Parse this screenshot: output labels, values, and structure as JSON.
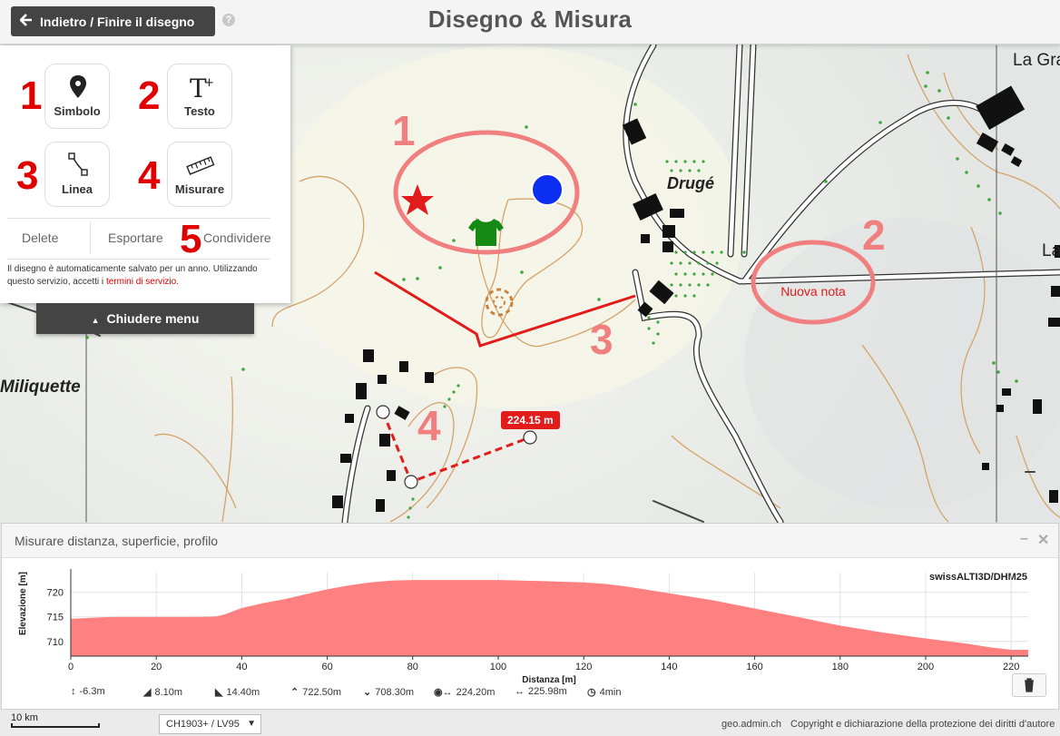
{
  "header": {
    "back_label": "Indietro / Finire il disegno",
    "title": "Disegno & Misura",
    "help_glyph": "?"
  },
  "tools": [
    {
      "number": "1",
      "label": "Simbolo",
      "icon": "map-marker-icon"
    },
    {
      "number": "2",
      "label": "Testo",
      "icon": "text-add-icon"
    },
    {
      "number": "3",
      "label": "Linea",
      "icon": "line-icon"
    },
    {
      "number": "4",
      "label": "Misurare",
      "icon": "ruler-icon"
    }
  ],
  "actions": {
    "delete": "Delete",
    "export": "Esportare",
    "share_number": "5",
    "share": "Condividere"
  },
  "notice": {
    "text": "Il disegno è automaticamente salvato per un anno. Utilizzando questo servizio, accetti i ",
    "link": "termini di servizio",
    "end": "."
  },
  "close_menu": "Chiudere menu",
  "map": {
    "places": [
      "La Gra",
      "Drugé",
      "La",
      "Miliquette"
    ],
    "annotations": [
      "1",
      "2",
      "3",
      "4"
    ],
    "note_text": "Nuova nota",
    "measure_label": "224.15 m",
    "colors": {
      "red": "#e21b1b",
      "pink": "#f08080",
      "blue": "#0b2ef0",
      "green": "#148a14"
    }
  },
  "profile": {
    "title": "Misurare distanza, superficie, profilo",
    "minimize": "–",
    "close": "✕",
    "stats": [
      {
        "icon": "updown-arrow-icon",
        "value": "-6.3m"
      },
      {
        "icon": "ascent-icon",
        "value": "8.10m"
      },
      {
        "icon": "descent-icon",
        "value": "14.40m"
      },
      {
        "icon": "chevron-up-icon",
        "value": "722.50m"
      },
      {
        "icon": "chevron-down-icon",
        "value": "708.30m"
      },
      {
        "icon": "eye-distance-icon",
        "value": "224.20m"
      },
      {
        "icon": "horizontal-distance-icon",
        "value": "225.98m"
      },
      {
        "icon": "clock-icon",
        "value": "4min"
      }
    ]
  },
  "chart_data": {
    "type": "area",
    "title": "swissALTI3D/DHM25",
    "xlabel": "Distanza [m]",
    "ylabel": "Elevazione [m]",
    "xlim": [
      0,
      224
    ],
    "ylim": [
      707,
      724
    ],
    "x_ticks": [
      0,
      20,
      40,
      60,
      80,
      100,
      120,
      140,
      160,
      180,
      200,
      220
    ],
    "y_ticks": [
      710,
      715,
      720
    ],
    "grid": true,
    "color": "#ff8080",
    "x": [
      0,
      5,
      10,
      20,
      30,
      34,
      36,
      40,
      45,
      50,
      55,
      60,
      65,
      70,
      75,
      80,
      90,
      100,
      110,
      120,
      125,
      130,
      140,
      150,
      160,
      170,
      180,
      190,
      200,
      210,
      215,
      220,
      224
    ],
    "y": [
      714.6,
      714.8,
      715.0,
      715.0,
      715.0,
      715.1,
      715.5,
      716.8,
      717.8,
      718.6,
      719.6,
      720.6,
      721.4,
      722.0,
      722.4,
      722.5,
      722.5,
      722.5,
      722.3,
      722.0,
      721.7,
      721.2,
      719.8,
      718.4,
      716.7,
      715.0,
      713.2,
      711.8,
      710.6,
      709.5,
      708.8,
      708.3,
      708.3
    ]
  },
  "footer": {
    "scale_label": "10 km",
    "crs": "CH1903+ / LV95",
    "crs_caret": "▼",
    "attribution": "geo.admin.ch",
    "copyright": "Copyright e dichiarazione della protezione dei diritti d'autore"
  }
}
